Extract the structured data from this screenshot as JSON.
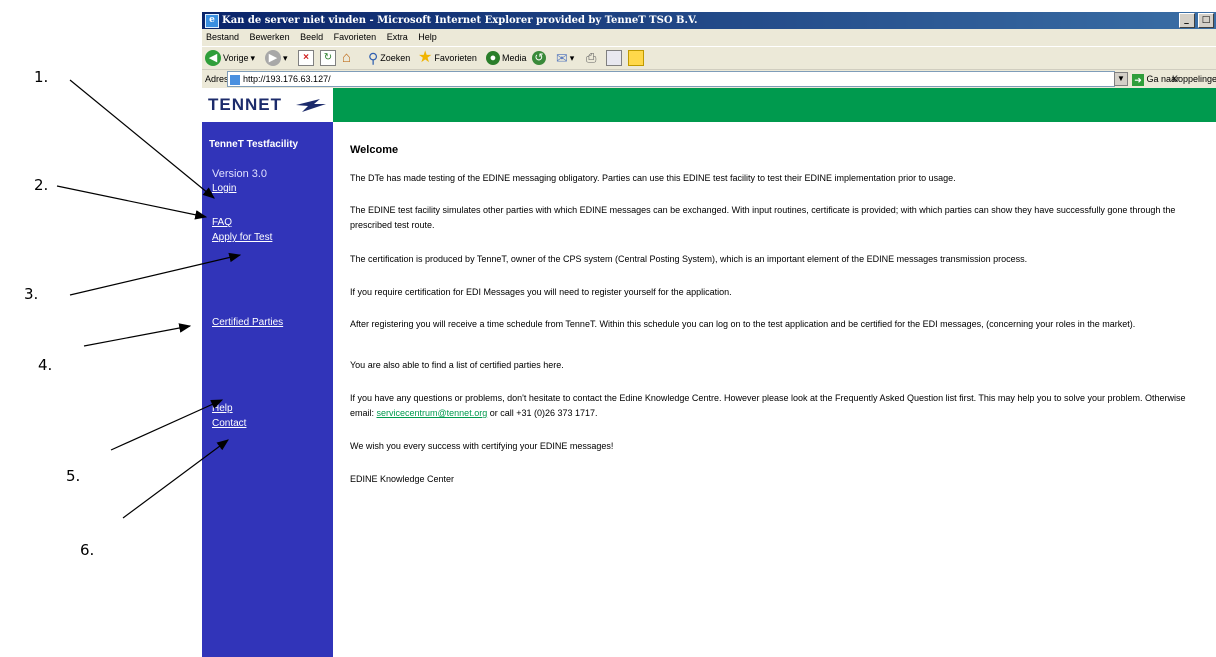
{
  "annotations": [
    "1.",
    "2.",
    "3.",
    "4.",
    "5.",
    "6."
  ],
  "browser": {
    "title": "Kan de server niet vinden - Microsoft Internet Explorer provided by TenneT TSO B.V.",
    "window_buttons": [
      "_",
      "□",
      "×"
    ],
    "menu": [
      "Bestand",
      "Bewerken",
      "Beeld",
      "Favorieten",
      "Extra",
      "Help"
    ],
    "toolbar": {
      "back": "Vorige",
      "search": "Zoeken",
      "favorites": "Favorieten",
      "media": "Media"
    },
    "address": {
      "label": "Adres",
      "url": "http://193.176.63.127/",
      "go": "Ga naar",
      "links": "Koppelinge"
    }
  },
  "site": {
    "logo_text": "TenneT",
    "sidebar": {
      "title": "TenneT Testfacility",
      "version": "Version 3.0",
      "links": {
        "login": "Login",
        "faq": "FAQ",
        "apply": "Apply for Test",
        "certified": "Certified Parties",
        "help": "Help",
        "contact": "Contact"
      }
    },
    "content": {
      "heading": "Welcome",
      "p1": "The DTe has made testing of the EDINE messaging obligatory. Parties can use this EDINE test facility to test their EDINE implementation prior to usage.",
      "p2": "The EDINE test facility simulates other parties with which EDINE messages can be exchanged. With input routines, certificate is provided; with which parties can show they have successfully gone through the prescribed test route.",
      "p3": "The certification is produced by TenneT, owner of the CPS system (Central Posting System), which is an important element of the EDINE messages transmission process.",
      "p4": "If you require certification for EDI Messages you will need to register yourself for the application.",
      "p5": "After registering you will receive a time schedule from TenneT. Within this schedule you can log on to the test application and be certified for the EDI messages, (concerning your roles in the market).",
      "p6": "You are also able to find a list of certified parties here.",
      "p7_pre": "If you have any questions or problems, don't hesitate to contact the Edine Knowledge Centre. However please look at the Frequently Asked Question list first. This may help you to solve your problem. Otherwise email: ",
      "p7_email": "servicecentrum@tennet.org",
      "p7_post": " or call +31 (0)26 373 1717.",
      "p8": "We wish you every success with certifying your EDINE messages!",
      "p9": "EDINE Knowledge Center"
    }
  },
  "colors": {
    "sidebar": "#3134b9",
    "header_green": "#009a4e",
    "titlebar": "#0a246a"
  }
}
